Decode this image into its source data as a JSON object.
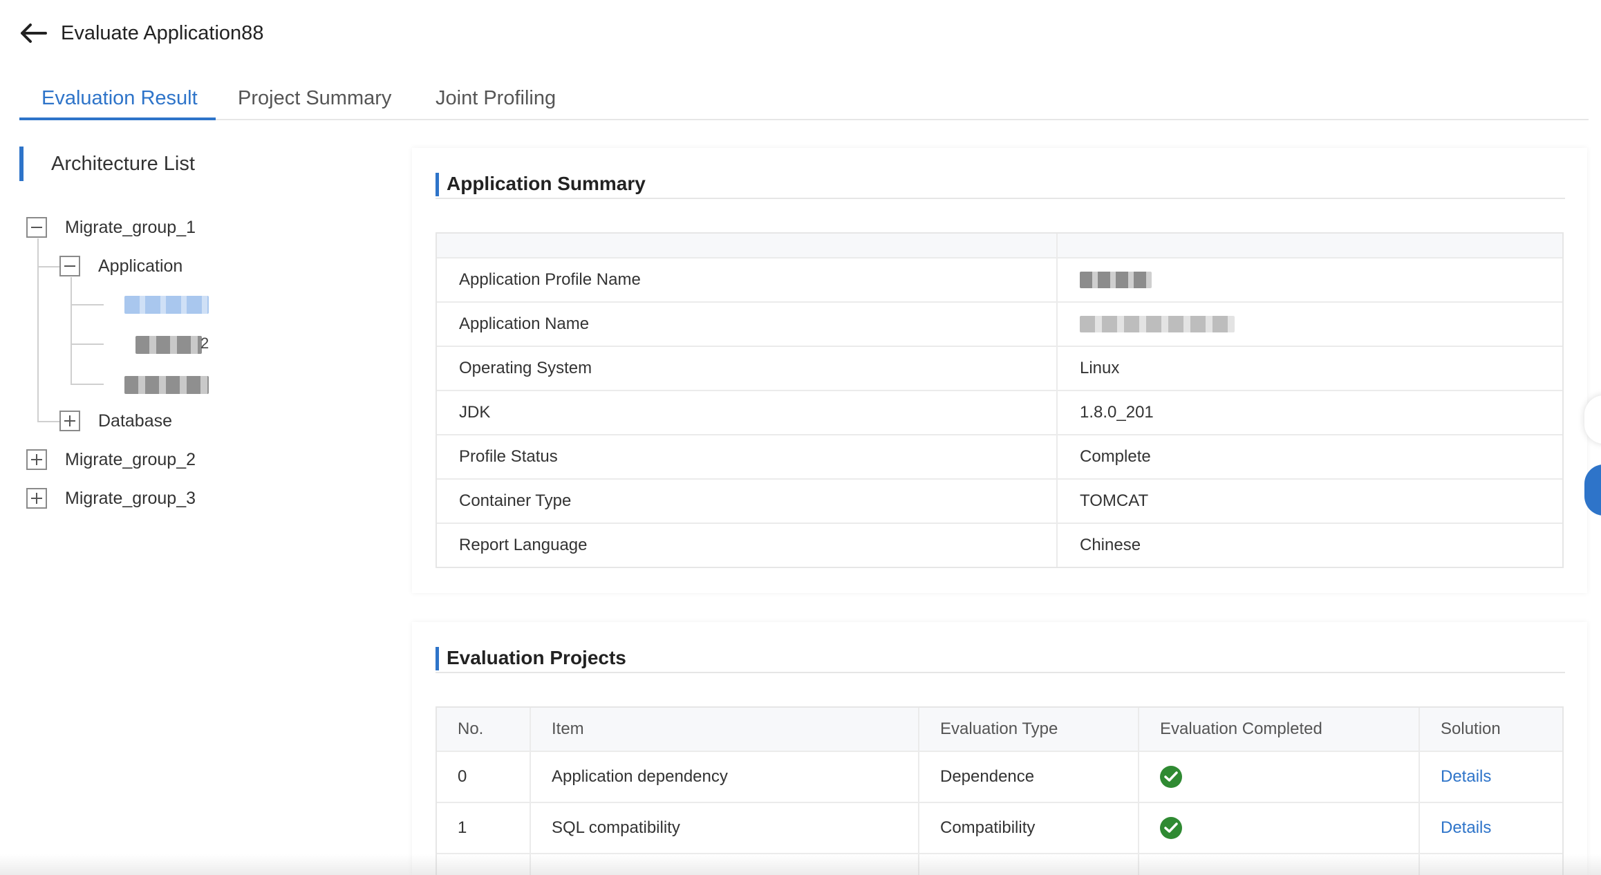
{
  "header": {
    "title": "Evaluate Application88"
  },
  "tabs": [
    {
      "label": "Evaluation Result",
      "active": true
    },
    {
      "label": "Project Summary",
      "active": false
    },
    {
      "label": "Joint Profiling",
      "active": false
    }
  ],
  "architecture": {
    "title": "Architecture List",
    "groups": [
      {
        "label": "Migrate_group_1",
        "expanded": true,
        "children": [
          {
            "label": "Application",
            "expanded": true,
            "items_redacted": 3,
            "item_2_suffix": "2"
          },
          {
            "label": "Database",
            "expanded": false
          }
        ]
      },
      {
        "label": "Migrate_group_2",
        "expanded": false
      },
      {
        "label": "Migrate_group_3",
        "expanded": false
      }
    ]
  },
  "summary": {
    "title": "Application Summary",
    "rows": [
      {
        "key": "Application Profile Name",
        "value": ""
      },
      {
        "key": "Application Name",
        "value": ""
      },
      {
        "key": "Operating System",
        "value": "Linux"
      },
      {
        "key": "JDK",
        "value": "1.8.0_201"
      },
      {
        "key": "Profile Status",
        "value": "Complete"
      },
      {
        "key": "Container Type",
        "value": "TOMCAT"
      },
      {
        "key": "Report Language",
        "value": "Chinese"
      }
    ]
  },
  "projects": {
    "title": "Evaluation Projects",
    "columns": [
      "No.",
      "Item",
      "Evaluation Type",
      "Evaluation Completed",
      "Solution"
    ],
    "rows": [
      {
        "no": "0",
        "item": "Application dependency",
        "type": "Dependence",
        "completed": true,
        "solution": "Details"
      },
      {
        "no": "1",
        "item": "SQL compatibility",
        "type": "Compatibility",
        "completed": true,
        "solution": "Details"
      }
    ]
  },
  "colors": {
    "accent": "#2e74c9",
    "success": "#2f8a32",
    "border": "#e6e6e6"
  }
}
